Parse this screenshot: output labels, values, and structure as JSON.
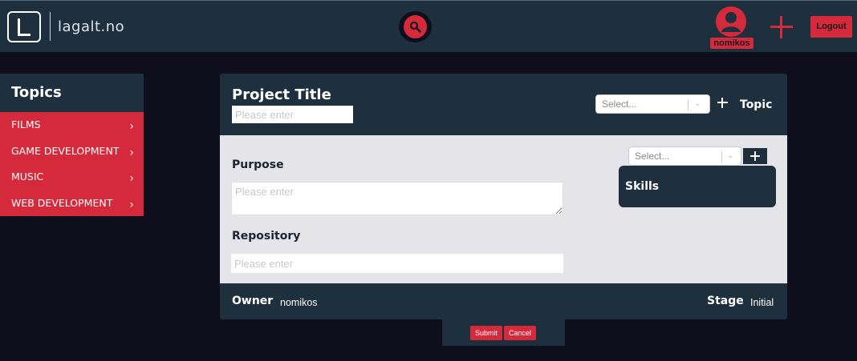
{
  "header": {
    "brand": "lagalt.no",
    "username": "nomikos",
    "logout_label": "Logout",
    "accent_color": "#d42a3c",
    "icons": [
      "logo-icon",
      "search-icon",
      "user-avatar-icon",
      "plus-icon"
    ]
  },
  "sidebar": {
    "title": "Topics",
    "items": [
      {
        "label": "FILMS"
      },
      {
        "label": "GAME DEVELOPMENT"
      },
      {
        "label": "MUSIC"
      },
      {
        "label": "WEB DEVELOPMENT"
      }
    ],
    "chevron": "›"
  },
  "form": {
    "project_title_label": "Project Title",
    "project_title_placeholder": "Please enter",
    "topic_select_placeholder": "Select...",
    "topic_label": "Topic",
    "purpose_label": "Purpose",
    "purpose_placeholder": "Please enter",
    "repository_label": "Repository",
    "repository_placeholder": "Please enter",
    "skill_select_placeholder": "Select...",
    "skills_label": "Skills",
    "owner_label": "Owner",
    "owner_value": "nomikos",
    "stage_label": "Stage",
    "stage_value": "Initial"
  },
  "actions": {
    "submit_label": "Submit",
    "cancel_label": "Cancel"
  }
}
